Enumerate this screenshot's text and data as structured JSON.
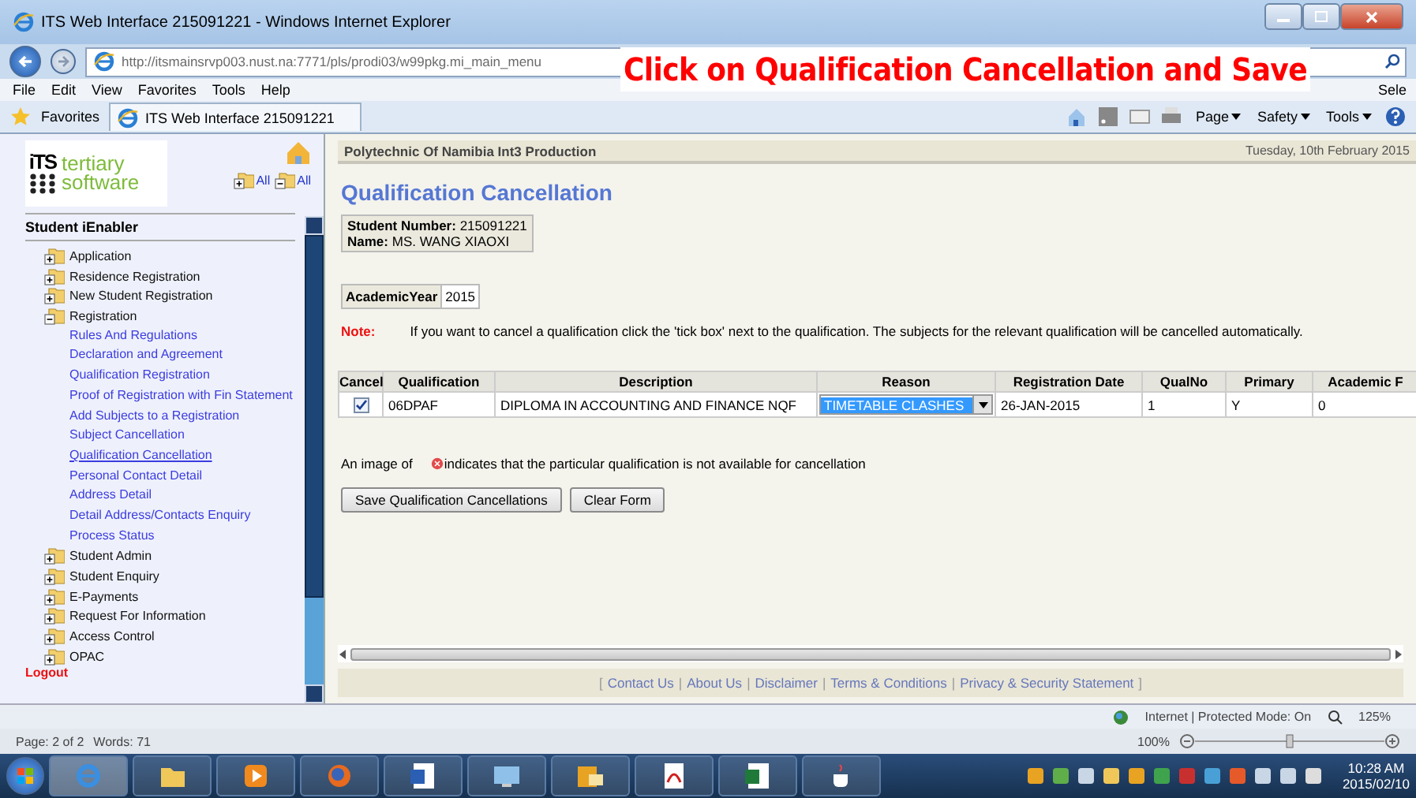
{
  "browser": {
    "title": "ITS Web Interface 215091221 - Windows Internet Explorer",
    "address": "http://itsmainsrvp003.nust.na:7771/pls/prodi03/w99pkg.mi_main_menu",
    "menu": [
      "File",
      "Edit",
      "View",
      "Favorites",
      "Tools",
      "Help"
    ],
    "search_cut": "Sele",
    "favorites": "Favorites",
    "tab": "ITS Web Interface 215091221",
    "commands": [
      "Page",
      "Safety",
      "Tools"
    ]
  },
  "annotation": "Click on Qualification Cancellation and Save",
  "sidebar": {
    "logo": {
      "mark": "iTS",
      "line1": "tertiary",
      "line2": "software"
    },
    "expand_all": "All",
    "collapse_all": "All",
    "title": "Student iEnabler",
    "items": [
      {
        "label": "Application",
        "expanded": false
      },
      {
        "label": "Residence Registration",
        "expanded": false
      },
      {
        "label": "New Student Registration",
        "expanded": false
      },
      {
        "label": "Registration",
        "expanded": true,
        "children": [
          {
            "label": "Rules And Regulations",
            "selected": false
          },
          {
            "label": "Declaration and Agreement",
            "selected": false
          },
          {
            "label": "Qualification Registration",
            "selected": false
          },
          {
            "label": "Proof of Registration with Fin Statement",
            "selected": false
          },
          {
            "label": "Add Subjects to a Registration",
            "selected": false
          },
          {
            "label": "Subject Cancellation",
            "selected": false
          },
          {
            "label": "Qualification Cancellation",
            "selected": true
          },
          {
            "label": "Personal Contact Detail",
            "selected": false
          },
          {
            "label": "Address Detail",
            "selected": false
          },
          {
            "label": "Detail Address/Contacts Enquiry",
            "selected": false
          },
          {
            "label": "Process Status",
            "selected": false
          }
        ]
      },
      {
        "label": "Student Admin",
        "expanded": false
      },
      {
        "label": "Student Enquiry",
        "expanded": false
      },
      {
        "label": "E-Payments",
        "expanded": false
      },
      {
        "label": "Request For Information",
        "expanded": false
      },
      {
        "label": "Access Control",
        "expanded": false
      },
      {
        "label": "OPAC",
        "expanded": false
      }
    ],
    "logout": "Logout"
  },
  "header": {
    "institution": "Polytechnic Of Namibia Int3 Production",
    "date": "Tuesday, 10th February 2015"
  },
  "page_title": "Qualification Cancellation",
  "student": {
    "number_label": "Student Number:",
    "number": "215091221",
    "name_label": "Name:",
    "name": "MS. WANG XIAOXI"
  },
  "academic_year": {
    "label": "AcademicYear",
    "value": "2015"
  },
  "note": {
    "label": "Note:",
    "text": "If you want to cancel a qualification click the 'tick box' next to the qualification. The subjects for the relevant qualification will be cancelled automatically."
  },
  "table": {
    "columns": [
      "Cancel",
      "Qualification",
      "Description",
      "Reason",
      "Registration Date",
      "QualNo",
      "Primary",
      "Academic F"
    ],
    "rows": [
      {
        "cancel": true,
        "qualification": "06DPAF",
        "description": "DIPLOMA IN ACCOUNTING AND FINANCE NQF",
        "reason": "TIMETABLE CLASHES",
        "registration_date": "26-JAN-2015",
        "qual_no": "1",
        "primary": "Y",
        "column_8": "0"
      }
    ]
  },
  "legend": {
    "before": "An image of",
    "after": "indicates that the particular qualification is not available for cancellation"
  },
  "buttons": [
    "Save Qualification Cancellations",
    "Clear Form"
  ],
  "footer": {
    "open": "[",
    "separator": "|",
    "close": "]",
    "links": [
      "Contact Us",
      "About Us",
      "Disclaimer",
      "Terms & Conditions",
      "Privacy & Security Statement"
    ]
  },
  "ie_status": {
    "zone": "Internet | Protected Mode: On",
    "zoom": "125%"
  },
  "word_status": {
    "page": "Page: 2 of 2",
    "words": "Words: 71",
    "zoom": "100%"
  },
  "taskbar": {
    "time": "10:28 AM",
    "date": "2015/02/10"
  }
}
